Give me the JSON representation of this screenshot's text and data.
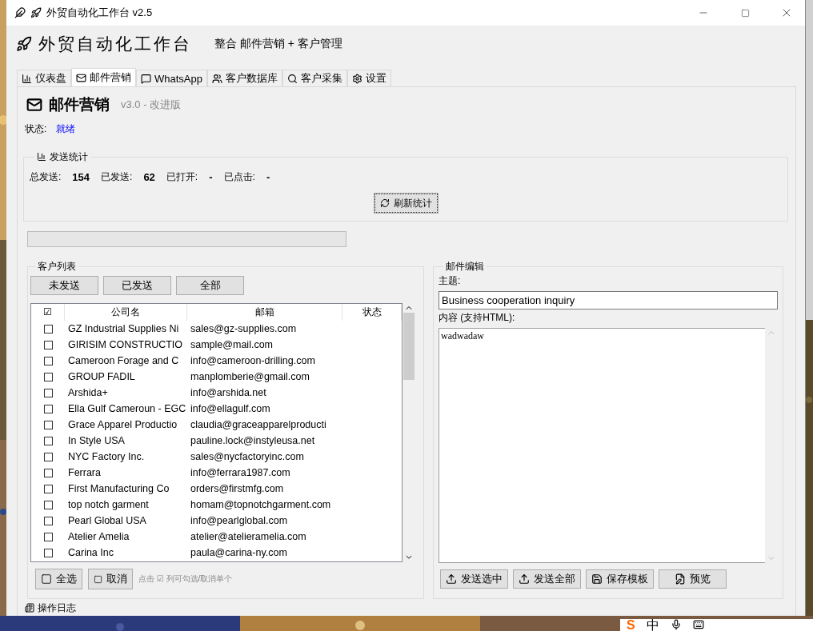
{
  "window": {
    "title": "外贸自动化工作台 v2.5"
  },
  "header": {
    "title": "外贸自动化工作台",
    "subtitle": "整合 邮件营销 + 客户管理"
  },
  "tabs": [
    {
      "label": "仪表盘",
      "selected": false
    },
    {
      "label": "邮件营销",
      "selected": true
    },
    {
      "label": "WhatsApp",
      "selected": false
    },
    {
      "label": "客户数据库",
      "selected": false
    },
    {
      "label": "客户采集",
      "selected": false
    },
    {
      "label": "设置",
      "selected": false
    }
  ],
  "page": {
    "title": "邮件营销",
    "version": "v3.0 - 改进版",
    "status_label": "状态:",
    "status": "就绪"
  },
  "stats": {
    "title": "发送统计",
    "items": [
      {
        "label": "总发送:",
        "value": "154"
      },
      {
        "label": "已发送:",
        "value": "62"
      },
      {
        "label": "已打开:",
        "value": "-"
      },
      {
        "label": "已点击:",
        "value": "-"
      }
    ],
    "refresh_button": "刷新统计"
  },
  "progress": {
    "level": 0
  },
  "customers": {
    "title": "客户列表",
    "filters": [
      "未发送",
      "已发送",
      "全部"
    ],
    "columns": [
      "☑",
      "公司名",
      "邮箱",
      "状态"
    ],
    "rows": [
      {
        "checked": false,
        "company": "GZ Industrial Supplies Ni",
        "email": "sales@gz-supplies.com"
      },
      {
        "checked": false,
        "company": "GIRISIM CONSTRUCTIO",
        "email": "sample@mail.com"
      },
      {
        "checked": false,
        "company": "Cameroon Forage and C",
        "email": "info@cameroon-drilling.com"
      },
      {
        "checked": false,
        "company": "GROUP FADIL",
        "email": "manplomberie@gmail.com"
      },
      {
        "checked": false,
        "company": "Arshida+",
        "email": "info@arshida.net"
      },
      {
        "checked": false,
        "company": "Ella Gulf Cameroun - EGC",
        "email": "info@ellagulf.com"
      },
      {
        "checked": false,
        "company": "Grace Apparel Productio",
        "email": "claudia@graceapparelproducti"
      },
      {
        "checked": false,
        "company": "In Style USA",
        "email": "pauline.lock@instyleusa.net"
      },
      {
        "checked": false,
        "company": "NYC Factory Inc.",
        "email": "sales@nycfactoryinc.com"
      },
      {
        "checked": false,
        "company": "Ferrara",
        "email": "info@ferrara1987.com"
      },
      {
        "checked": false,
        "company": "First Manufacturing Co",
        "email": "orders@firstmfg.com"
      },
      {
        "checked": false,
        "company": "top notch garment",
        "email": "homam@topnotchgarment.com"
      },
      {
        "checked": false,
        "company": "Pearl Global USA",
        "email": "info@pearlglobal.com"
      },
      {
        "checked": false,
        "company": "Atelier Amelia",
        "email": "atelier@atelieramelia.com"
      },
      {
        "checked": false,
        "company": "Carina Inc",
        "email": "paula@carina-ny.com"
      }
    ],
    "select_all": "全选",
    "cancel": "取消",
    "hint": "点击 ☑ 列可勾选/取消单个"
  },
  "editor": {
    "title": "邮件编辑",
    "subject_label": "主题:",
    "subject": "Business cooperation inquiry",
    "body_label": "内容 (支持HTML):",
    "body": "wadwadaw",
    "buttons": [
      "发送选中",
      "发送全部",
      "保存模板",
      "预览"
    ]
  },
  "log": {
    "title": "操作日志"
  },
  "ime": {
    "logo": "S",
    "label": "中"
  }
}
